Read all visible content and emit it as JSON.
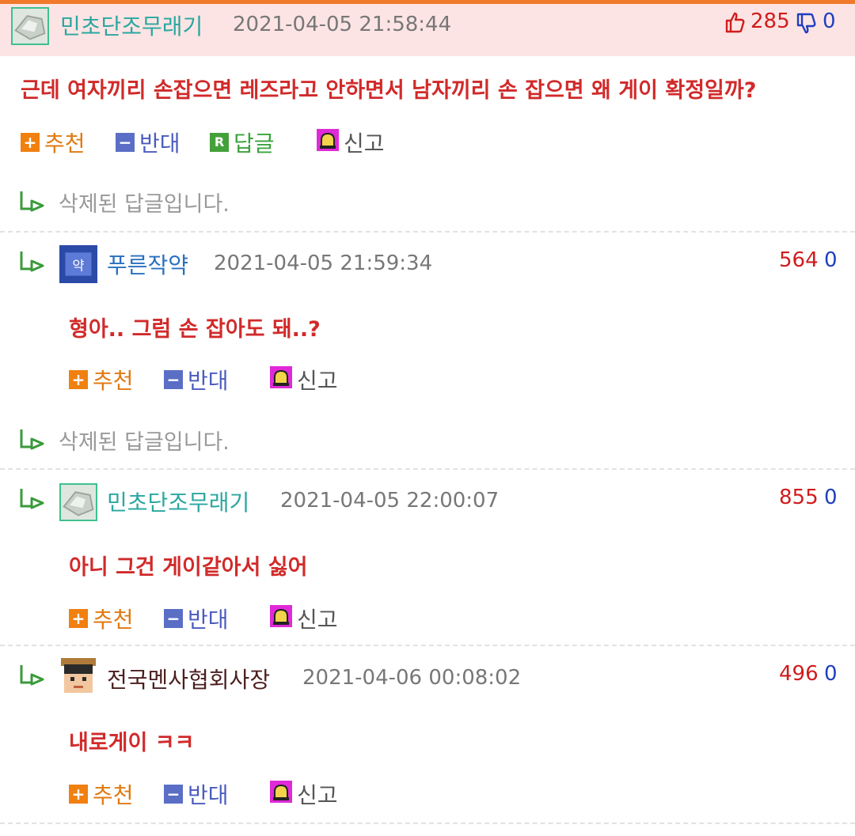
{
  "colors": {
    "topbar": "#f07a2a",
    "highlight": "#fde4e4",
    "nick": "#2aa7a0",
    "body": "#d12a2a",
    "up": "#d01c1c",
    "down": "#1f3fbf"
  },
  "main": {
    "nick": "민초단조무래기",
    "date": "2021-04-05 21:58:44",
    "up": "285",
    "down": "0",
    "text": "근데 여자끼리 손잡으면 레즈라고 안하면서 남자끼리 손 잡으면 왜 게이 확정일까?"
  },
  "actions": {
    "recommend": "추천",
    "oppose": "반대",
    "reply": "답글",
    "report": "신고",
    "reply_badge": "R"
  },
  "deleted_text": "삭제된 답글입니다.",
  "replies": [
    {
      "nick": "푸른작약",
      "date": "2021-04-05 21:59:34",
      "up": "564",
      "down": "0",
      "text": "형아.. 그럼 손 잡아도 돼..?"
    },
    {
      "nick": "민초단조무래기",
      "date": "2021-04-05 22:00:07",
      "up": "855",
      "down": "0",
      "text": "아니 그건 게이같아서 싫어"
    },
    {
      "nick": "전국멘사협회사장",
      "date": "2021-04-06 00:08:02",
      "up": "496",
      "down": "0",
      "text": "내로게이 ㅋㅋ"
    }
  ],
  "icons": {
    "like": "thumbs-up-icon",
    "dislike": "thumbs-down-icon",
    "reply": "reply-arrow-icon",
    "report": "siren-icon"
  }
}
